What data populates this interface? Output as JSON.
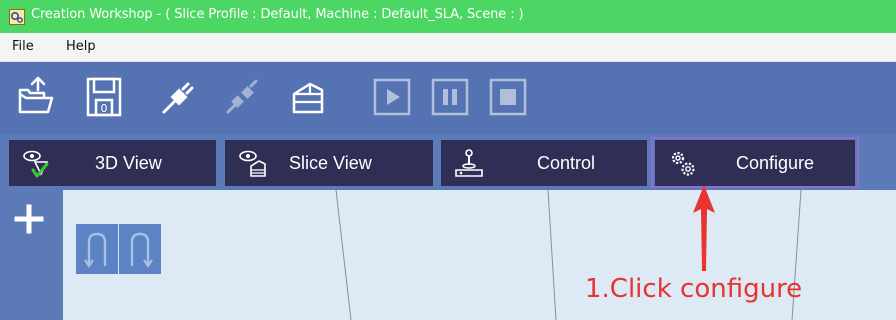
{
  "window": {
    "title": "Creation Workshop -   ( Slice Profile : Default, Machine : Default_SLA, Scene : )",
    "title_bar_color": "#4cd663"
  },
  "menu": {
    "items": [
      {
        "label": "File"
      },
      {
        "label": "Help"
      }
    ]
  },
  "toolbar": {
    "buttons": [
      {
        "icon": "open-folder-icon",
        "enabled": true
      },
      {
        "icon": "save-disk-icon",
        "enabled": true
      },
      {
        "icon": "connect-plug-icon",
        "enabled": true
      },
      {
        "icon": "disconnect-plug-icon",
        "enabled": false
      },
      {
        "icon": "slice-cake-icon",
        "enabled": true
      },
      {
        "icon": "play-icon",
        "enabled": false
      },
      {
        "icon": "pause-icon",
        "enabled": false
      },
      {
        "icon": "stop-icon",
        "enabled": false
      }
    ],
    "background": "#5572b2"
  },
  "tabs": [
    {
      "label": "3D View",
      "icon": "eye-3d-icon"
    },
    {
      "label": "Slice View",
      "icon": "eye-layers-icon"
    },
    {
      "label": "Control",
      "icon": "joystick-icon"
    },
    {
      "label": "Configure",
      "icon": "gears-icon"
    }
  ],
  "left_tools": {
    "add_icon": "plus-icon"
  },
  "viewport": {
    "background": "#dde9f4",
    "buttons": [
      {
        "icon": "rotate-left-icon"
      },
      {
        "icon": "rotate-right-icon"
      }
    ]
  },
  "annotation": {
    "text": "1.Click configure",
    "color": "#e8342c"
  }
}
